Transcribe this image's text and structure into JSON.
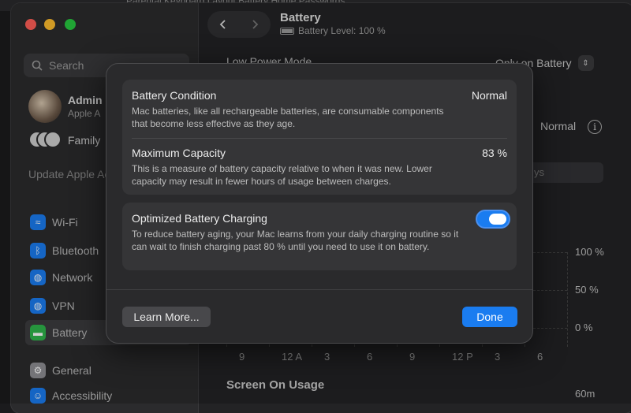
{
  "desktop": {
    "ghost_text": "Parental   Keyboard   Layout   Battery   Home   Passwords"
  },
  "sidebar": {
    "search_placeholder": "Search",
    "account": {
      "name": "Admin",
      "sub": "Apple A"
    },
    "family_label": "Family",
    "update_text": "Update Apple Account Settings",
    "items": [
      {
        "label": "Wi-Fi",
        "icon": "wifi-icon",
        "color": "#1a7cf0"
      },
      {
        "label": "Bluetooth",
        "icon": "bluetooth-icon",
        "color": "#1a7cf0"
      },
      {
        "label": "Network",
        "icon": "globe-icon",
        "color": "#1a7cf0"
      },
      {
        "label": "VPN",
        "icon": "vpn-globe-icon",
        "color": "#1a7cf0"
      },
      {
        "label": "Battery",
        "icon": "battery-icon",
        "color": "#2fb54b"
      },
      {
        "label": "General",
        "icon": "gear-icon",
        "color": "#8e8e93"
      },
      {
        "label": "Accessibility",
        "icon": "accessibility-icon",
        "color": "#1a7cf0"
      }
    ]
  },
  "header": {
    "title": "Battery",
    "battery_level": "Battery Level: 100 %"
  },
  "background": {
    "low_power_label": "Low Power Mode",
    "low_power_value": "Only on Battery",
    "health_value": "Normal",
    "pill_text": "ys",
    "y_labels": [
      "100 %",
      "50 %",
      "0 %"
    ],
    "x_labels": [
      "9",
      "12 A",
      "3",
      "6",
      "9",
      "12 P",
      "3",
      "6"
    ],
    "screen_on_title": "Screen On Usage",
    "y_60m": "60m"
  },
  "modal": {
    "battery_condition": {
      "title": "Battery Condition",
      "value": "Normal",
      "desc": "Mac batteries, like all rechargeable batteries, are consumable components that become less effective as they age."
    },
    "maximum_capacity": {
      "title": "Maximum Capacity",
      "value": "83 %",
      "desc": "This is a measure of battery capacity relative to when it was new. Lower capacity may result in fewer hours of usage between charges."
    },
    "optimized_charging": {
      "title": "Optimized Battery Charging",
      "desc": "To reduce battery aging, your Mac learns from your daily charging routine so it can wait to finish charging past 80 % until you need to use it on battery.",
      "enabled": true
    },
    "learn_more_label": "Learn More...",
    "done_label": "Done"
  },
  "colors": {
    "accent": "#1a7cf0",
    "battery_green": "#2fb54b"
  }
}
